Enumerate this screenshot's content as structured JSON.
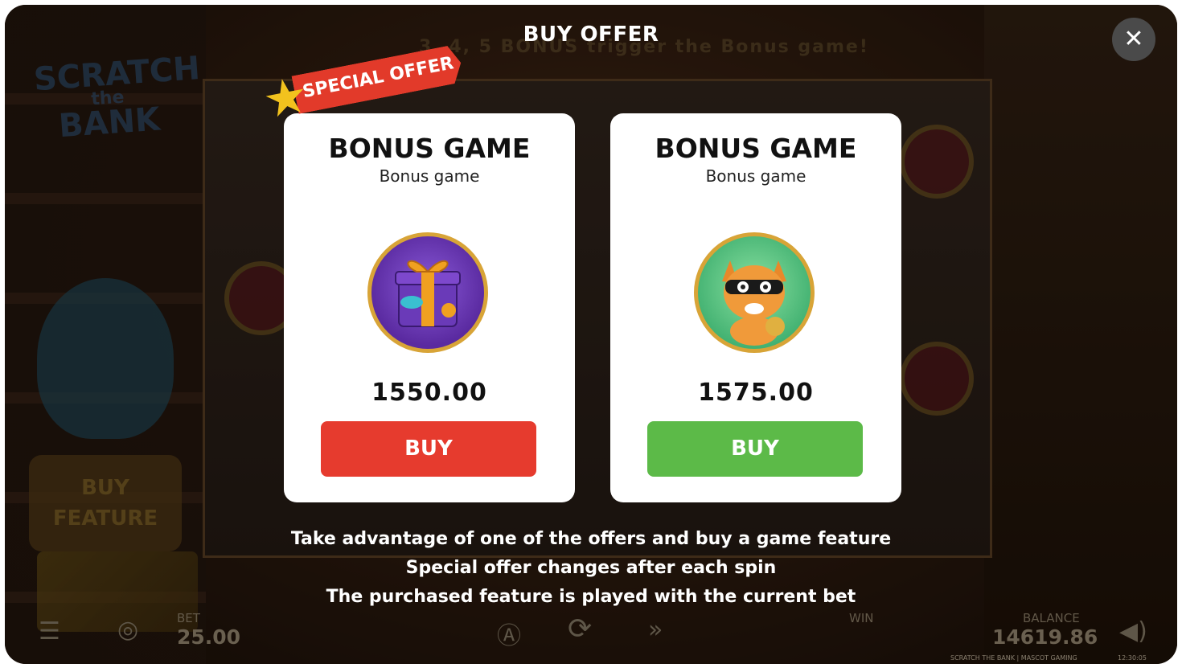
{
  "dialog": {
    "title": "BUY OFFER",
    "close_label": "✕"
  },
  "ribbon": {
    "label": "SPECIAL OFFER"
  },
  "offers": [
    {
      "title": "BONUS GAME",
      "subtitle": "Bonus game",
      "price": "1550.00",
      "button": "BUY",
      "button_color": "#e63b2e",
      "image": "gift-box-icon"
    },
    {
      "title": "BONUS GAME",
      "subtitle": "Bonus game",
      "price": "1575.00",
      "button": "BUY",
      "button_color": "#5cba48",
      "image": "bandit-cat-icon"
    }
  ],
  "info_lines": [
    "Take advantage of one of the offers and buy a game feature",
    "Special offer changes after each spin",
    "The purchased feature is played with the current bet"
  ],
  "background": {
    "logo_line1": "SCRATCH",
    "logo_line2": "the",
    "logo_line3": "BANK",
    "buy_feature_line1": "BUY",
    "buy_feature_line2": "FEATURE",
    "hint": "3, 4, 5  BONUS  trigger the Bonus game!"
  },
  "hud": {
    "bet_label": "BET",
    "bet_value": "25.00",
    "win_label": "WIN",
    "balance_label": "BALANCE",
    "balance_value": "14619.86",
    "footer_brand": "SCRATCH THE BANK | MASCOT GAMING",
    "clock": "12:30:05"
  }
}
